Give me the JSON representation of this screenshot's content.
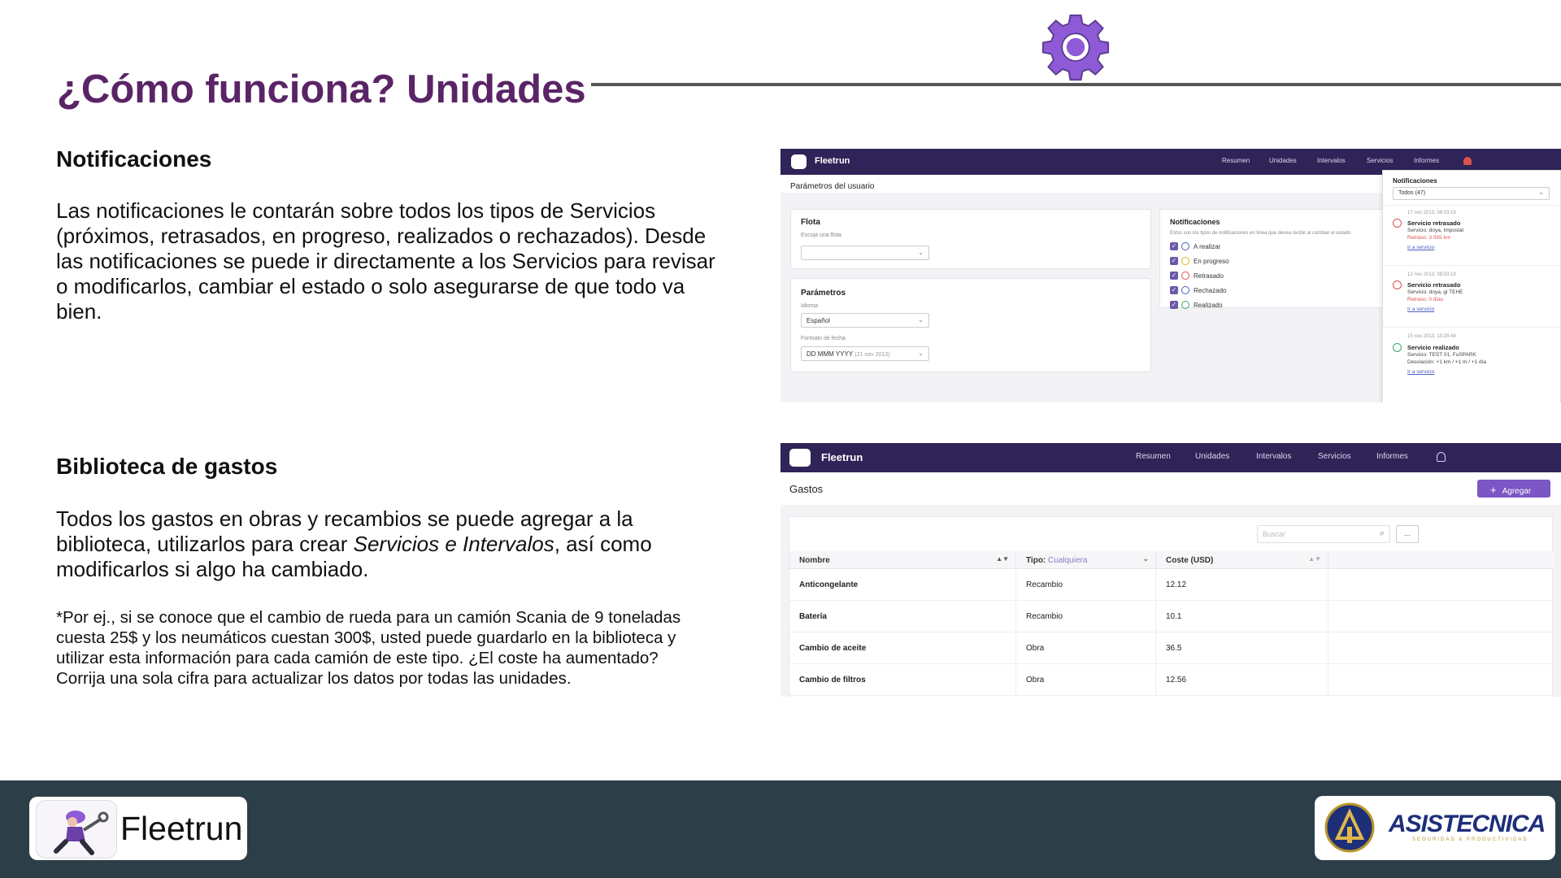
{
  "slide": {
    "title": "¿Cómo funciona? Unidades",
    "section1": {
      "heading": "Notificaciones",
      "text": "Las notificaciones le contarán sobre todos los tipos de Servicios (próximos, retrasados, en progreso, realizados o rechazados). Desde las notificaciones se puede ir directamente a los Servicios para revisar o  modificarlos, cambiar el estado o solo asegurarse de que todo va bien."
    },
    "section2": {
      "heading": "Biblioteca de gastos",
      "text_before": "Todos los gastos en obras y recambios se puede agregar a la biblioteca, utilizarlos para crear ",
      "text_italic": "Servicios e Intervalos",
      "text_after": ", así como modificarlos si algo ha cambiado.",
      "note": "*Por ej., si se conoce que el cambio de rueda para un camión Scania de 9 toneladas cuesta 25$ y los neumáticos cuestan 300$, usted puede guardarlo en la biblioteca y utilizar esta información para cada camión de este tipo. ¿El coste ha aumentado? Corrija una sola cifra para actualizar los datos por todas las unidades."
    }
  },
  "colors": {
    "title": "#5a2466",
    "accent": "#8e5ad6",
    "nav": "#2f2357",
    "footer": "#2c3e47"
  },
  "shot1": {
    "brand": "Fleetrun",
    "nav": [
      "Resumen",
      "Unidades",
      "Intervalos",
      "Servicios",
      "Informes"
    ],
    "page_title": "Parámetros del usuario",
    "flota": {
      "title": "Flota",
      "label": "Escoja una flota",
      "value": ""
    },
    "parametros": {
      "title": "Parámetros",
      "idioma_label": "Idioma",
      "idioma_value": "Español",
      "fecha_label": "Formato de fecha",
      "fecha_value": "DD MMM YYYY",
      "fecha_example": "(21 nov 2013)"
    },
    "notificaciones_panel": {
      "title": "Notificaciones",
      "desc": "Estos son los tipos de notificaciones en línea que desea recibir al cambiar el estado",
      "options": [
        "A realizar",
        "En progreso",
        "Retrasado",
        "Rechazado",
        "Realizado"
      ]
    },
    "dropdown": {
      "title": "Notificaciones",
      "filter": "Todos (47)",
      "items": [
        {
          "date": "17 nov 2013, 08:03:19",
          "title": "Servicio retrasado",
          "line1": "Servicio: doya, Impostal",
          "line2": "Retraso: 3 055 km",
          "link": "Ir a servicio"
        },
        {
          "date": "12 nov 2013, 08:03:19",
          "title": "Servicio retrasado",
          "line1": "Servicio: doya, gi TEHE",
          "line2": "Retraso: 0 días",
          "link": "Ir a servicio"
        },
        {
          "date": "15 nov 2013, 10:28:44",
          "title": "Servicio realizado",
          "line1": "Servicio: TEST 01, FuSPARK",
          "line2": "Desviación: +1 km / +1 m / +1 día",
          "link": "Ir a servicio"
        }
      ]
    }
  },
  "shot2": {
    "brand": "Fleetrun",
    "nav": [
      "Resumen",
      "Unidades",
      "Intervalos",
      "Servicios",
      "Informes"
    ],
    "page_title": "Gastos",
    "add_button": "Agregar",
    "search_placeholder": "Buscar",
    "more_button": "...",
    "columns": {
      "nombre": "Nombre",
      "tipo": "Tipo:",
      "tipo_value": "Cualquiera",
      "coste": "Coste (USD)"
    },
    "rows": [
      {
        "nombre": "Anticongelante",
        "tipo": "Recambio",
        "coste": "12.12"
      },
      {
        "nombre": "Batería",
        "tipo": "Recambio",
        "coste": "10.1"
      },
      {
        "nombre": "Cambio de aceite",
        "tipo": "Obra",
        "coste": "36.5"
      },
      {
        "nombre": "Cambio de filtros",
        "tipo": "Obra",
        "coste": "12.56"
      }
    ]
  },
  "footer": {
    "left_brand": "Fleetrun",
    "right_brand": "ASISTECNICA",
    "right_tagline": "SEGURIDAD & PRODUCTIVIDAD"
  }
}
